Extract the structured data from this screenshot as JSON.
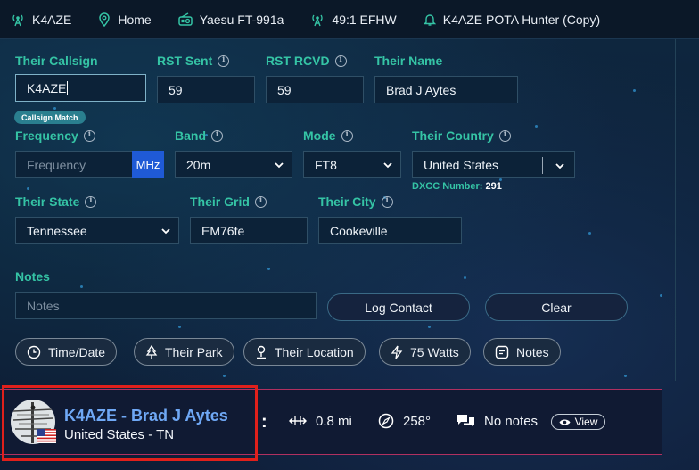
{
  "topbar": {
    "callsign": "K4AZE",
    "location": "Home",
    "radio": "Yaesu FT-991a",
    "antenna": "49:1 EFHW",
    "log": "K4AZE POTA Hunter (Copy)"
  },
  "form": {
    "their_callsign": {
      "label": "Their Callsign",
      "value": "K4AZE"
    },
    "callsign_badge": "Callsign Match",
    "rst_sent": {
      "label": "RST Sent",
      "value": "59"
    },
    "rst_rcvd": {
      "label": "RST RCVD",
      "value": "59"
    },
    "their_name": {
      "label": "Their Name",
      "value": "Brad J Aytes"
    },
    "frequency": {
      "label": "Frequency",
      "placeholder": "Frequency",
      "unit": "MHz"
    },
    "band": {
      "label": "Band",
      "value": "20m"
    },
    "mode": {
      "label": "Mode",
      "value": "FT8"
    },
    "their_country": {
      "label": "Their Country",
      "value": "United States"
    },
    "dxcc": {
      "label": "DXCC Number:",
      "value": "291"
    },
    "their_state": {
      "label": "Their State",
      "value": "Tennessee"
    },
    "their_grid": {
      "label": "Their Grid",
      "value": "EM76fe"
    },
    "their_city": {
      "label": "Their City",
      "value": "Cookeville"
    },
    "notes": {
      "label": "Notes",
      "placeholder": "Notes"
    }
  },
  "actions": {
    "log_contact": "Log Contact",
    "clear": "Clear"
  },
  "toggles": [
    "Time/Date",
    "Their Park",
    "Their Location",
    "75 Watts",
    "Notes"
  ],
  "contact_card": {
    "title": "K4AZE - Brad J Aytes",
    "location": "United States - TN",
    "distance": "0.8 mi",
    "bearing": "258°",
    "notes": "No notes",
    "view": "View"
  },
  "colors": {
    "accent": "#35c4a5",
    "name_blue": "#6fa8f5",
    "highlight": "#e0201b"
  }
}
